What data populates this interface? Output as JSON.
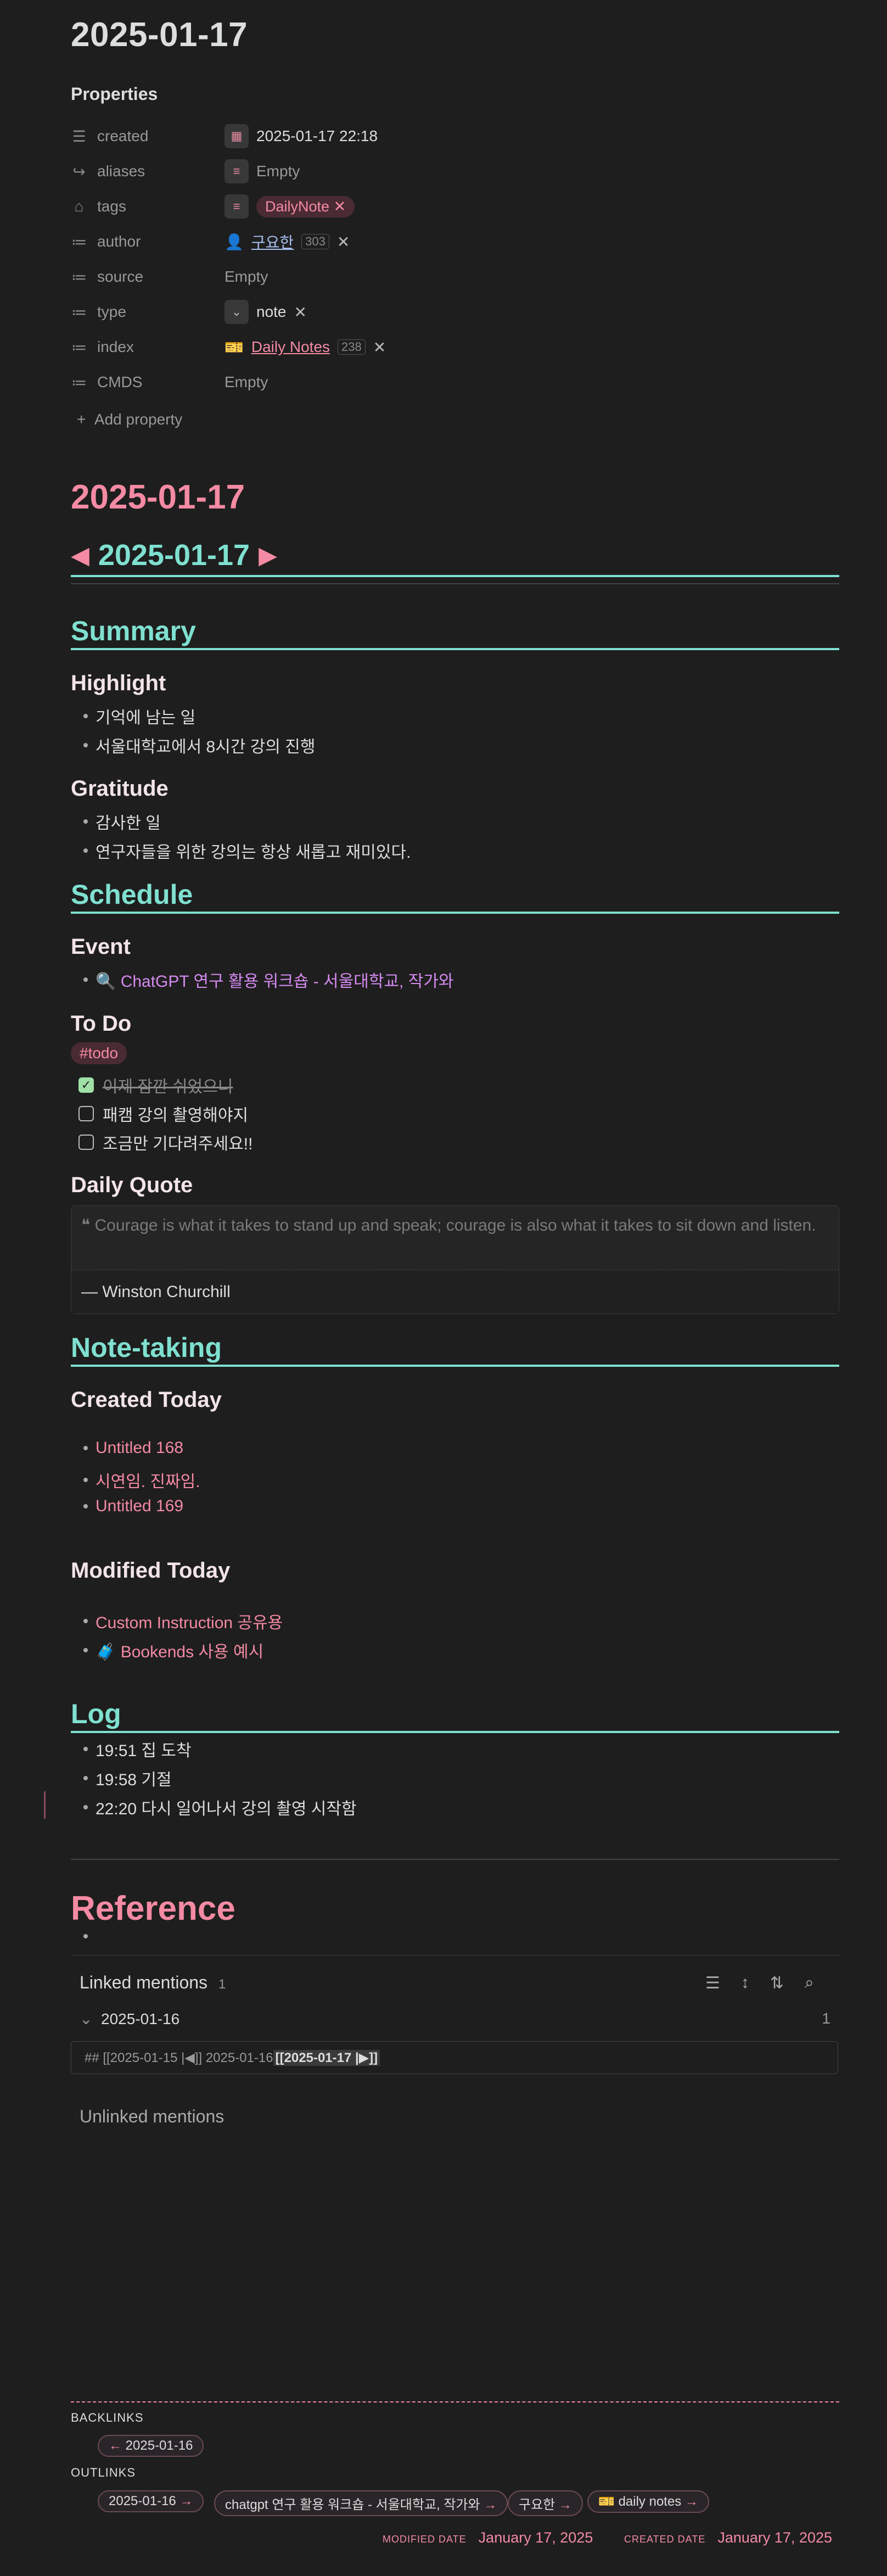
{
  "note_title": "2025-01-17",
  "properties": {
    "heading": "Properties",
    "created": {
      "key": "created",
      "value": "2025-01-17 22:18"
    },
    "aliases": {
      "key": "aliases",
      "value": "Empty"
    },
    "tags": {
      "key": "tags",
      "value": "DailyNote"
    },
    "author": {
      "key": "author",
      "value": "구요한",
      "count": "303"
    },
    "source": {
      "key": "source",
      "value": "Empty"
    },
    "type": {
      "key": "type",
      "value": "note"
    },
    "index": {
      "key": "index",
      "value": "Daily Notes",
      "count": "238"
    },
    "cmds": {
      "key": "CMDS",
      "value": "Empty"
    },
    "add_property": "Add property"
  },
  "body": {
    "heading_date": "2025-01-17",
    "nav": {
      "prev": "◀",
      "date": "2025-01-17",
      "next": "▶"
    },
    "summary": {
      "title": "Summary",
      "highlight_title": "Highlight",
      "highlight_items": [
        "기억에 남는 일",
        "서울대학교에서 8시간 강의 진행"
      ],
      "gratitude_title": "Gratitude",
      "gratitude_items": [
        "감사한 일",
        "연구자들을 위한 강의는 항상 새롭고 재미있다."
      ]
    },
    "schedule": {
      "title": "Schedule",
      "event_title": "Event",
      "event_item": "🔍 ChatGPT 연구 활용 워크숍 - 서울대학교, 작가와",
      "todo_title": "To Do",
      "todo_tag": "#todo",
      "tasks": [
        {
          "text": "이제 잠깐 쉬었으니",
          "done": true
        },
        {
          "text": "패캠 강의 촬영해야지",
          "done": false
        },
        {
          "text": "조금만 기다려주세요!!",
          "done": false
        }
      ],
      "quote_title": "Daily Quote",
      "quote_text": "Courage is what it takes to stand up and speak; courage is also what it takes to sit down and listen.",
      "quote_author": "— Winston Churchill"
    },
    "notetaking": {
      "title": "Note-taking",
      "created_title": "Created Today",
      "created_items": [
        "Untitled 168",
        "시연임. 진짜임.",
        "Untitled 169"
      ],
      "modified_title": "Modified Today",
      "modified_items": [
        "Custom Instruction 공유용",
        "🧳 Bookends 사용 예시"
      ]
    },
    "log": {
      "title": "Log",
      "items": [
        "19:51 집 도착",
        "19:58 기절",
        "22:20 다시 일어나서 강의 촬영 시작함"
      ]
    },
    "reference": {
      "title": "Reference"
    }
  },
  "linked_mentions": {
    "title": "Linked mentions",
    "count": "1",
    "item": "2025-01-16",
    "item_count": "1",
    "snippet_pre": "## [[2025-01-15 |◀]] 2025-01-16 ",
    "snippet_hl": "[[2025-01-17 |▶]]",
    "unlinked_title": "Unlinked mentions"
  },
  "footer": {
    "backlinks_label": "BACKLINKS",
    "backlinks": [
      "2025-01-16"
    ],
    "outlinks_label": "OUTLINKS",
    "outlinks": [
      "2025-01-16",
      "chatgpt 연구 활용 워크숍 - 서울대학교, 작가와",
      "구요한",
      "daily notes"
    ],
    "modified_label": "MODIFIED DATE",
    "modified_value": "January 17, 2025",
    "created_label": "CREATED DATE",
    "created_value": "January 17, 2025"
  },
  "colors": {
    "accent_teal": "#7fe0d0",
    "accent_pink": "#f48aa3",
    "link_purple": "#d58af0",
    "background": "#1e1e1e"
  }
}
